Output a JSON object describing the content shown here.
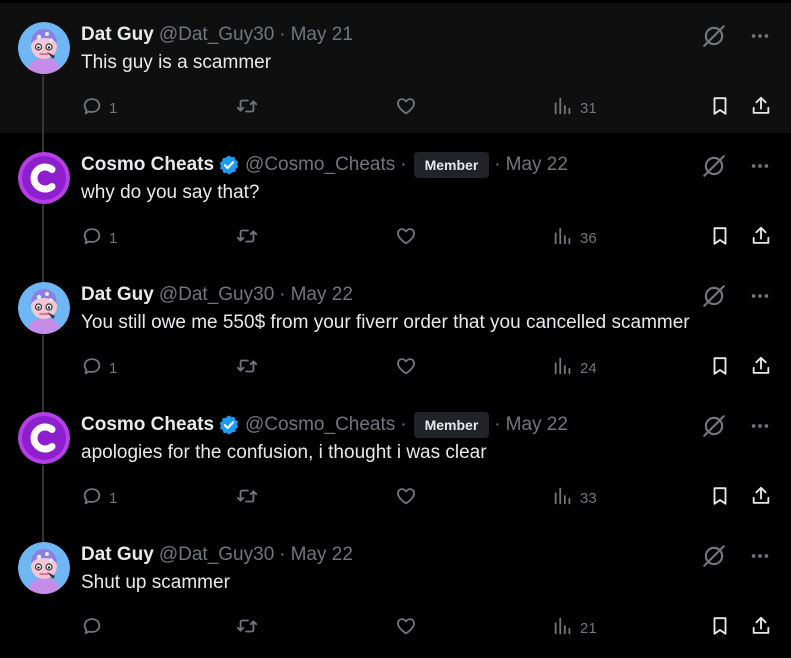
{
  "posts": [
    {
      "author": "Dat Guy",
      "handle": "@Dat_Guy30",
      "date": "May 21",
      "text": "This guy is a scammer",
      "verified": false,
      "member_badge": "",
      "replies": "1",
      "views": "31",
      "highlighted": true
    },
    {
      "author": "Cosmo Cheats",
      "handle": "@Cosmo_Cheats",
      "date": "May 22",
      "text": "why do you say that?",
      "verified": true,
      "member_badge": "Member",
      "replies": "1",
      "views": "36",
      "highlighted": false
    },
    {
      "author": "Dat Guy",
      "handle": "@Dat_Guy30",
      "date": "May 22",
      "text": "You still owe me 550$ from your fiverr order that you cancelled scammer",
      "verified": false,
      "member_badge": "",
      "replies": "1",
      "views": "24",
      "highlighted": false
    },
    {
      "author": "Cosmo Cheats",
      "handle": "@Cosmo_Cheats",
      "date": "May 22",
      "text": "apologies for the confusion, i thought i was clear",
      "verified": true,
      "member_badge": "Member",
      "replies": "1",
      "views": "33",
      "highlighted": false
    },
    {
      "author": "Dat Guy",
      "handle": "@Dat_Guy30",
      "date": "May 22",
      "text": "Shut up scammer",
      "verified": false,
      "member_badge": "",
      "replies": "",
      "views": "21",
      "highlighted": false
    }
  ],
  "separator": "·",
  "colors": {
    "background": "#000000",
    "highlight_background": "#0f0f0f",
    "muted_text": "#71767b",
    "verified_blue": "#1d9bf0",
    "cosmo_purple": "#9b2fd6"
  },
  "icons": [
    "grok-icon",
    "more-icon",
    "reply-icon",
    "retweet-icon",
    "like-icon",
    "views-icon",
    "bookmark-icon",
    "share-icon",
    "verified-badge-icon"
  ]
}
